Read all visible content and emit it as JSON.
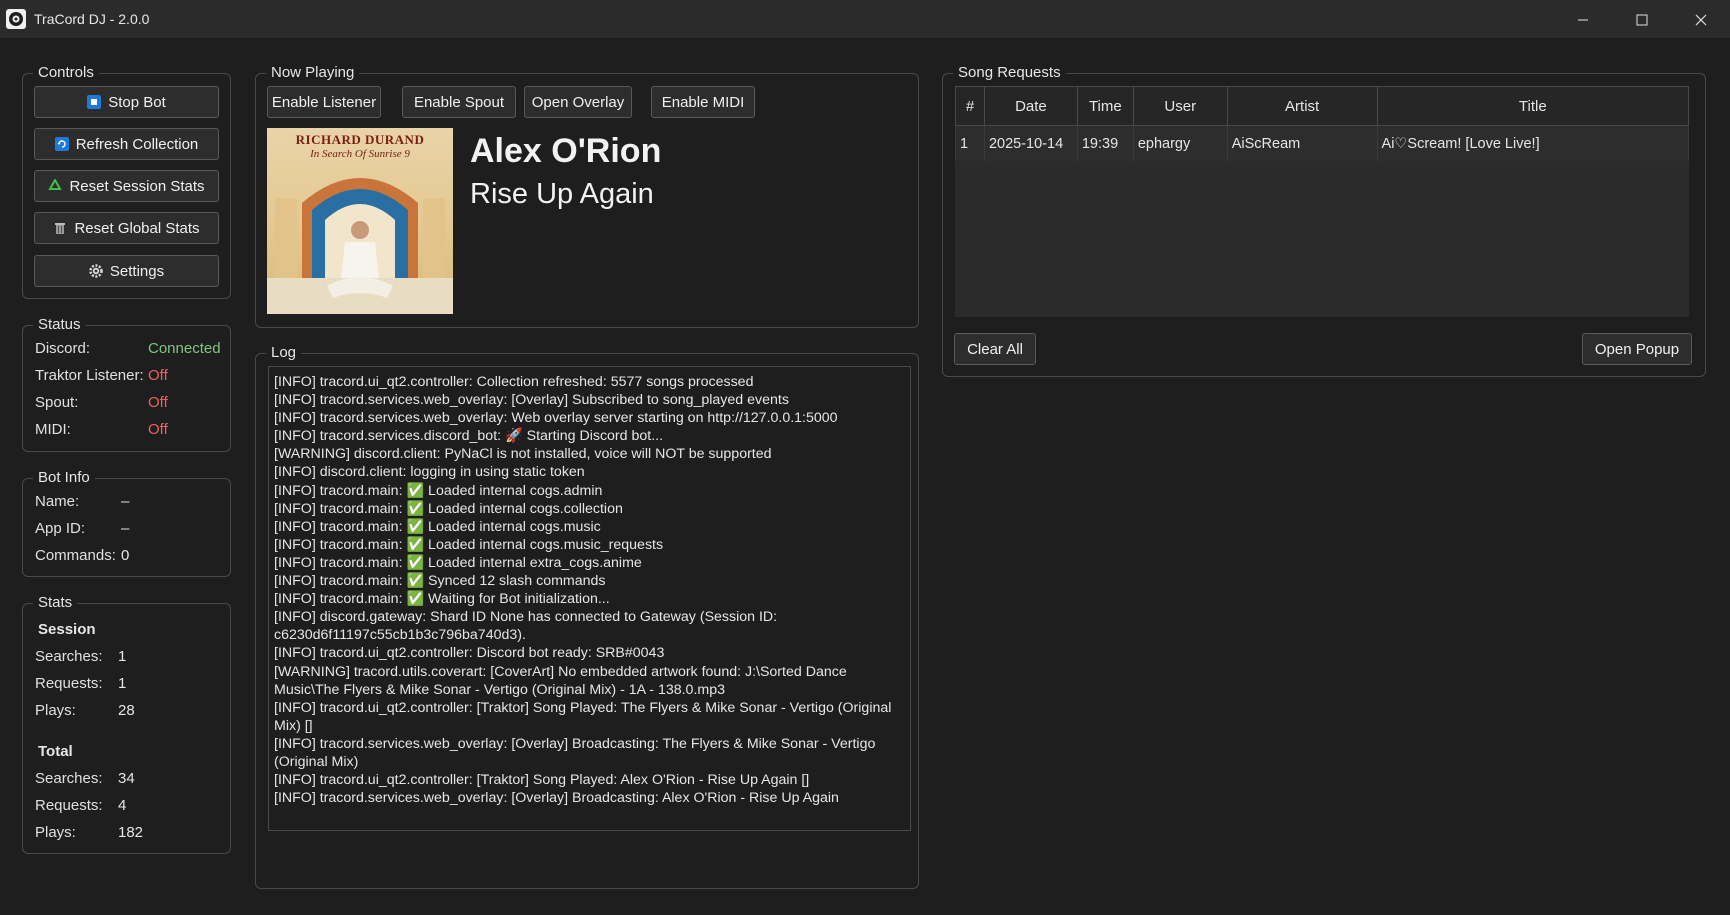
{
  "window": {
    "title": "TraCord DJ - 2.0.0"
  },
  "controls": {
    "title": "Controls",
    "buttons": [
      {
        "label": "Stop Bot",
        "icon": "stop-icon"
      },
      {
        "label": "Refresh Collection",
        "icon": "refresh-icon"
      },
      {
        "label": "Reset Session Stats",
        "icon": "recycle-icon"
      },
      {
        "label": "Reset Global Stats",
        "icon": "trash-icon"
      },
      {
        "label": "Settings",
        "icon": "gear-icon"
      }
    ]
  },
  "status": {
    "title": "Status",
    "discord_label": "Discord:",
    "discord_value": "Connected",
    "traktor_label": "Traktor Listener:",
    "traktor_value": "Off",
    "spout_label": "Spout:",
    "spout_value": "Off",
    "midi_label": "MIDI:",
    "midi_value": "Off"
  },
  "bot_info": {
    "title": "Bot Info",
    "name_label": "Name:",
    "name_value": "–",
    "appid_label": "App ID:",
    "appid_value": "–",
    "commands_label": "Commands:",
    "commands_value": "0"
  },
  "stats": {
    "title": "Stats",
    "session_heading": "Session",
    "session": {
      "searches_label": "Searches:",
      "searches": "1",
      "requests_label": "Requests:",
      "requests": "1",
      "plays_label": "Plays:",
      "plays": "28"
    },
    "total_heading": "Total",
    "total": {
      "searches_label": "Searches:",
      "searches": "34",
      "requests_label": "Requests:",
      "requests": "4",
      "plays_label": "Plays:",
      "plays": "182"
    }
  },
  "now_playing": {
    "title": "Now Playing",
    "buttons": [
      "Enable Listener",
      "Enable Spout",
      "Open Overlay",
      "Enable MIDI"
    ],
    "artist": "Alex O'Rion",
    "track": "Rise Up Again",
    "cover_text": "RICHARD DURAND",
    "cover_subtitle": "In Search Of Sunrise 9"
  },
  "log": {
    "title": "Log",
    "lines": [
      "[INFO] tracord.ui_qt2.controller: Collection refreshed: 5577 songs processed",
      "[INFO] tracord.services.web_overlay: [Overlay] Subscribed to song_played events",
      "[INFO] tracord.services.web_overlay: Web overlay server starting on http://127.0.0.1:5000",
      "[INFO] tracord.services.discord_bot: 🚀 Starting Discord bot...",
      "[WARNING] discord.client: PyNaCl is not installed, voice will NOT be supported",
      "[INFO] discord.client: logging in using static token",
      "[INFO] tracord.main: ✅ Loaded internal cogs.admin",
      "[INFO] tracord.main: ✅ Loaded internal cogs.collection",
      "[INFO] tracord.main: ✅ Loaded internal cogs.music",
      "[INFO] tracord.main: ✅ Loaded internal cogs.music_requests",
      "[INFO] tracord.main: ✅ Loaded internal extra_cogs.anime",
      "[INFO] tracord.main: ✅ Synced 12 slash commands",
      "[INFO] tracord.main: ✅ Waiting for Bot initialization...",
      "[INFO] discord.gateway: Shard ID None has connected to Gateway (Session ID: c6230d6f11197c55cb1b3c796ba740d3).",
      "[INFO] tracord.ui_qt2.controller: Discord bot ready: SRB#0043",
      "[WARNING] tracord.utils.coverart: [CoverArt] No embedded artwork found: J:\\Sorted Dance Music\\The Flyers & Mike Sonar - Vertigo (Original Mix) - 1A - 138.0.mp3",
      "[INFO] tracord.ui_qt2.controller: [Traktor] Song Played: The Flyers & Mike Sonar - Vertigo (Original Mix) []",
      "[INFO] tracord.services.web_overlay: [Overlay] Broadcasting: The Flyers & Mike Sonar - Vertigo (Original Mix)",
      "[INFO] tracord.ui_qt2.controller: [Traktor] Song Played: Alex O'Rion - Rise Up Again []",
      "[INFO] tracord.services.web_overlay: [Overlay] Broadcasting: Alex O'Rion - Rise Up Again"
    ]
  },
  "song_requests": {
    "title": "Song Requests",
    "columns": [
      "#",
      "Date",
      "Time",
      "User",
      "Artist",
      "Title"
    ],
    "rows": [
      [
        "1",
        "2025-10-14",
        "19:39",
        "ephargy",
        "AiScReam",
        "Ai♡Scream! [Love Live!]"
      ]
    ],
    "clear_all_label": "Clear All",
    "open_popup_label": "Open Popup"
  }
}
